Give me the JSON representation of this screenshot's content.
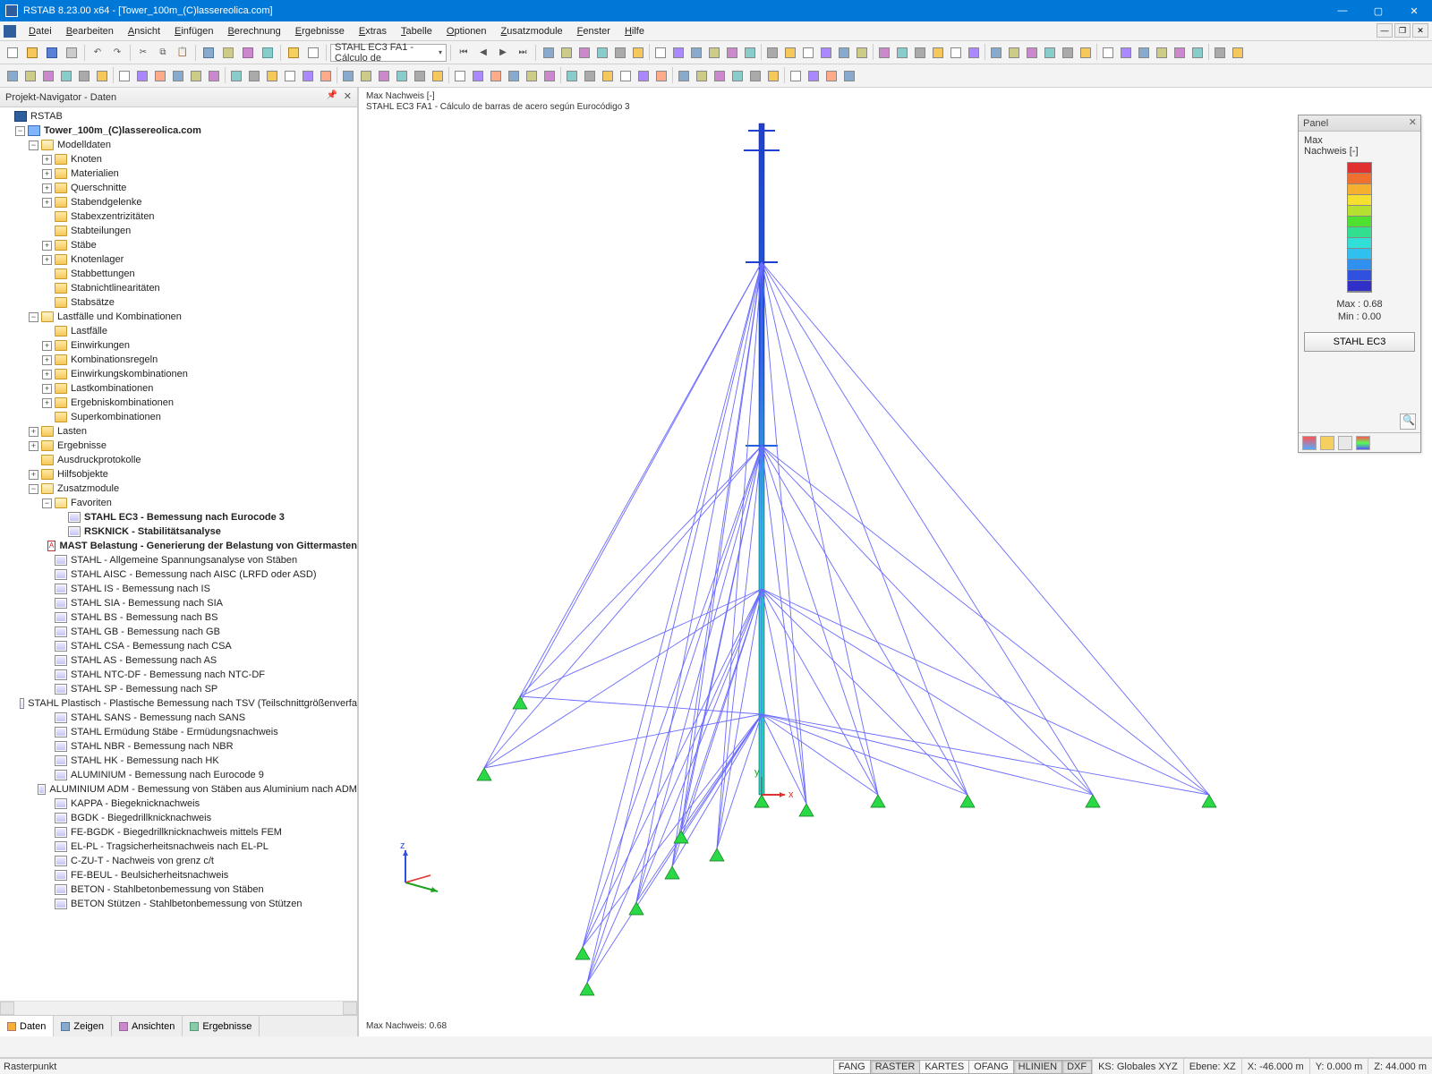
{
  "title": "RSTAB 8.23.00 x64 - [Tower_100m_(C)lassereolica.com]",
  "menu": [
    "Datei",
    "Bearbeiten",
    "Ansicht",
    "Einfügen",
    "Berechnung",
    "Ergebnisse",
    "Extras",
    "Tabelle",
    "Optionen",
    "Zusatzmodule",
    "Fenster",
    "Hilfe"
  ],
  "combo_module": "STAHL EC3 FA1 - Cálculo de",
  "nav": {
    "title": "Projekt-Navigator - Daten",
    "root": "RSTAB",
    "project": "Tower_100m_(C)lassereolica.com",
    "modelldaten": "Modelldaten",
    "modelldaten_items": [
      "Knoten",
      "Materialien",
      "Querschnitte",
      "Stabendgelenke",
      "Stabexzentrizitäten",
      "Stabteilungen",
      "Stäbe",
      "Knotenlager",
      "Stabbettungen",
      "Stabnichtlinearitäten",
      "Stabsätze"
    ],
    "lastfaelle": "Lastfälle und Kombinationen",
    "lastfaelle_items": [
      "Lastfälle",
      "Einwirkungen",
      "Kombinationsregeln",
      "Einwirkungskombinationen",
      "Lastkombinationen",
      "Ergebniskombinationen",
      "Superkombinationen"
    ],
    "other_top": [
      "Lasten",
      "Ergebnisse",
      "Ausdruckprotokolle",
      "Hilfsobjekte"
    ],
    "zusatz": "Zusatzmodule",
    "fav": "Favoriten",
    "fav_items": [
      "STAHL EC3 - Bemessung nach Eurocode 3",
      "RSKNICK - Stabilitätsanalyse",
      "MAST Belastung - Generierung der Belastung von Gittermasten"
    ],
    "modules": [
      "STAHL - Allgemeine Spannungsanalyse von Stäben",
      "STAHL AISC - Bemessung nach AISC (LRFD oder ASD)",
      "STAHL IS - Bemessung nach IS",
      "STAHL SIA - Bemessung nach SIA",
      "STAHL BS - Bemessung nach BS",
      "STAHL GB - Bemessung nach GB",
      "STAHL CSA - Bemessung nach CSA",
      "STAHL AS - Bemessung nach AS",
      "STAHL NTC-DF - Bemessung nach NTC-DF",
      "STAHL SP - Bemessung nach SP",
      "STAHL Plastisch - Plastische Bemessung nach TSV (Teilschnittgrößenverfa",
      "STAHL SANS - Bemessung nach SANS",
      "STAHL Ermüdung Stäbe - Ermüdungsnachweis",
      "STAHL NBR - Bemessung nach NBR",
      "STAHL HK - Bemessung nach HK",
      "ALUMINIUM - Bemessung nach Eurocode 9",
      "ALUMINIUM ADM - Bemessung von Stäben aus Aluminium nach ADM",
      "KAPPA - Biegeknicknachweis",
      "BGDK - Biegedrillknicknachweis",
      "FE-BGDK - Biegedrillknicknachweis mittels FEM",
      "EL-PL - Tragsicherheitsnachweis nach EL-PL",
      "C-ZU-T - Nachweis von grenz c/t",
      "FE-BEUL - Beulsicherheitsnachweis",
      "BETON - Stahlbetonbemessung von Stäben",
      "BETON Stützen - Stahlbetonbemessung von Stützen"
    ],
    "tabs": [
      "Daten",
      "Zeigen",
      "Ansichten",
      "Ergebnisse"
    ]
  },
  "viewport": {
    "line1": "Max Nachweis [-]",
    "line2": "STAHL EC3 FA1 - Cálculo de barras de acero según Eurocódigo 3",
    "bottom": "Max Nachweis: 0.68"
  },
  "panel": {
    "title": "Panel",
    "l1": "Max",
    "l2": "Nachweis [-]",
    "max": "Max  :  0.68",
    "min": "Min   :  0.00",
    "btn": "STAHL EC3"
  },
  "status": {
    "left": "Rasterpunkt",
    "tabs": [
      "FANG",
      "RASTER",
      "KARTES",
      "OFANG",
      "HLINIEN",
      "DXF"
    ],
    "ks": "KS: Globales XYZ",
    "ebene": "Ebene: XZ",
    "x": "X: -46.000 m",
    "y": "Y: 0.000 m",
    "z": "Z: 44.000 m"
  },
  "colors": {
    "scale": [
      "#e03030",
      "#f07030",
      "#f5b030",
      "#f5e030",
      "#b5e030",
      "#50e030",
      "#30e090",
      "#30e0d8",
      "#30c0f0",
      "#3090f0",
      "#3050e0",
      "#3030c8"
    ]
  }
}
